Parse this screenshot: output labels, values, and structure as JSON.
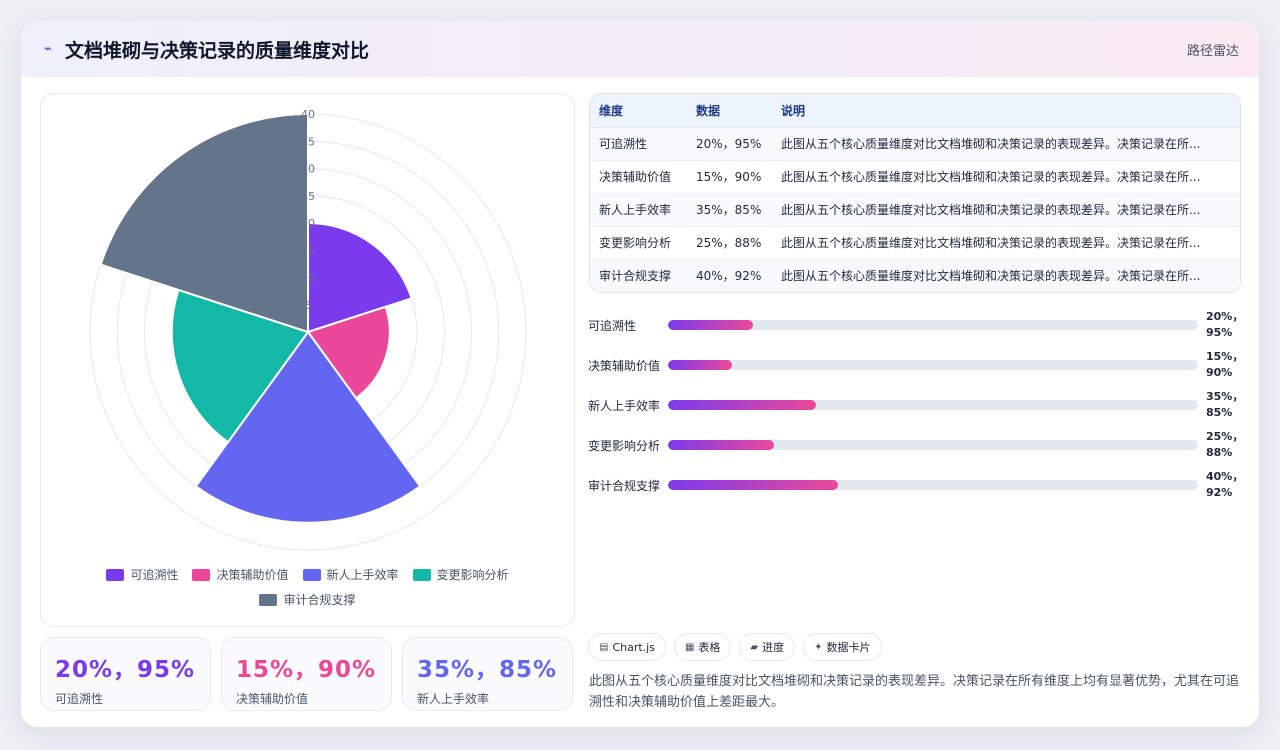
{
  "header": {
    "icon": "pulse-icon",
    "title": "文档堆砌与决策记录的质量维度对比",
    "badge": "路径雷达"
  },
  "chart_data": {
    "type": "polar-area",
    "categories": [
      "可追溯性",
      "决策辅助价值",
      "新人上手效率",
      "变更影响分析",
      "审计合规支撑"
    ],
    "values": [
      20,
      15,
      35,
      25,
      40
    ],
    "colors": [
      "#7c3aed",
      "#ec4899",
      "#6366f1",
      "#14b8a6",
      "#64748b"
    ],
    "rlim": [
      0,
      40
    ],
    "ticks": [
      5,
      10,
      15,
      20,
      25,
      30,
      35,
      40
    ],
    "tick_labels": [
      "5",
      "10",
      "15",
      "20",
      "25",
      "30",
      "35",
      "40"
    ],
    "legend_position": "bottom"
  },
  "legend": [
    {
      "label": "可追溯性",
      "color": "#7c3aed"
    },
    {
      "label": "决策辅助价值",
      "color": "#ec4899"
    },
    {
      "label": "新人上手效率",
      "color": "#6366f1"
    },
    {
      "label": "变更影响分析",
      "color": "#14b8a6"
    },
    {
      "label": "审计合规支撑",
      "color": "#64748b"
    }
  ],
  "stats": [
    {
      "value": "20%，95%",
      "label": "可追溯性",
      "color": "#7c3aed"
    },
    {
      "value": "15%，90%",
      "label": "决策辅助价值",
      "color": "#ec4899"
    },
    {
      "value": "35%，85%",
      "label": "新人上手效率",
      "color": "#6366f1"
    }
  ],
  "table": {
    "headers": [
      "维度",
      "数据",
      "说明"
    ],
    "rows": [
      [
        "可追溯性",
        "20%，95%",
        "此图从五个核心质量维度对比文档堆砌和决策记录的表现差异。决策记录在所..."
      ],
      [
        "决策辅助价值",
        "15%，90%",
        "此图从五个核心质量维度对比文档堆砌和决策记录的表现差异。决策记录在所..."
      ],
      [
        "新人上手效率",
        "35%，85%",
        "此图从五个核心质量维度对比文档堆砌和决策记录的表现差异。决策记录在所..."
      ],
      [
        "变更影响分析",
        "25%，88%",
        "此图从五个核心质量维度对比文档堆砌和决策记录的表现差异。决策记录在所..."
      ],
      [
        "审计合规支撑",
        "40%，92%",
        "此图从五个核心质量维度对比文档堆砌和决策记录的表现差异。决策记录在所..."
      ]
    ]
  },
  "bars": [
    {
      "label": "可追溯性",
      "value_text": "20%，95%",
      "progress": 0.16
    },
    {
      "label": "决策辅助价值",
      "value_text": "15%，90%",
      "progress": 0.12
    },
    {
      "label": "新人上手效率",
      "value_text": "35%，85%",
      "progress": 0.28
    },
    {
      "label": "变更影响分析",
      "value_text": "25%，88%",
      "progress": 0.2
    },
    {
      "label": "审计合规支撑",
      "value_text": "40%，92%",
      "progress": 0.32
    }
  ],
  "chips": [
    {
      "icon": "chart-icon",
      "glyph": "▤",
      "label": "Chart.js"
    },
    {
      "icon": "table-icon",
      "glyph": "▦",
      "label": "表格"
    },
    {
      "icon": "folder-icon",
      "glyph": "▰",
      "label": "进度"
    },
    {
      "icon": "sparkle-icon",
      "glyph": "✦",
      "label": "数据卡片"
    }
  ],
  "summary": "此图从五个核心质量维度对比文档堆砌和决策记录的表现差异。决策记录在所有维度上均有显著优势，尤其在可追溯性和决策辅助价值上差距最大。"
}
